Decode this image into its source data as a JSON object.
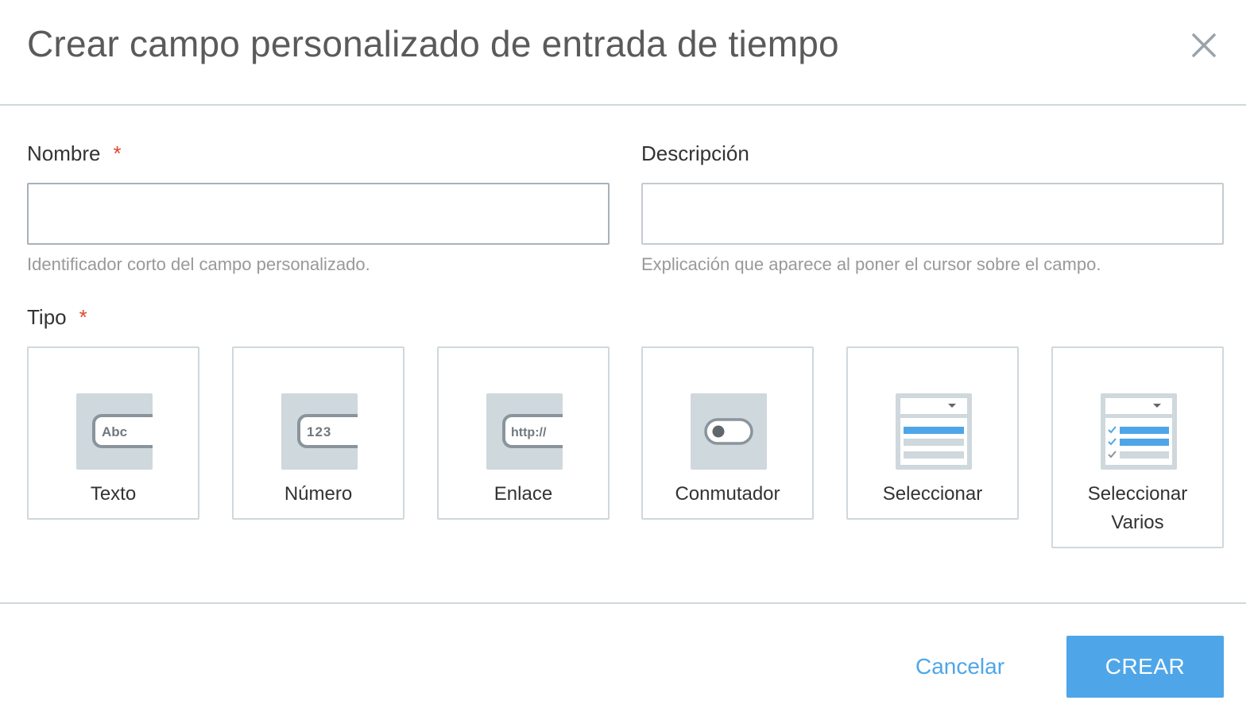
{
  "dialog": {
    "title": "Crear campo personalizado de entrada de tiempo"
  },
  "form": {
    "name": {
      "label": "Nombre",
      "required_mark": "*",
      "value": "",
      "placeholder": "",
      "hint": "Identificador corto del campo personalizado."
    },
    "description": {
      "label": "Descripción",
      "value": "",
      "placeholder": "",
      "hint": "Explicación que aparece al poner el cursor sobre el campo."
    },
    "type": {
      "label": "Tipo",
      "required_mark": "*",
      "options": [
        {
          "label": "Texto",
          "icon": "text-field-icon",
          "icon_text": "Abc"
        },
        {
          "label": "Número",
          "icon": "number-field-icon",
          "icon_text": "123"
        },
        {
          "label": "Enlace",
          "icon": "link-field-icon",
          "icon_text": "http://"
        },
        {
          "label": "Conmutador",
          "icon": "toggle-switch-icon"
        },
        {
          "label": "Seleccionar",
          "icon": "dropdown-select-icon"
        },
        {
          "label": "Seleccionar Varios",
          "icon": "multi-select-icon"
        }
      ]
    }
  },
  "actions": {
    "cancel_label": "Cancelar",
    "create_label": "CREAR"
  },
  "colors": {
    "accent": "#4ea6e8",
    "required": "#e0452b",
    "icon_bg": "#cfd8dc",
    "icon_dark": "#8a949c"
  }
}
